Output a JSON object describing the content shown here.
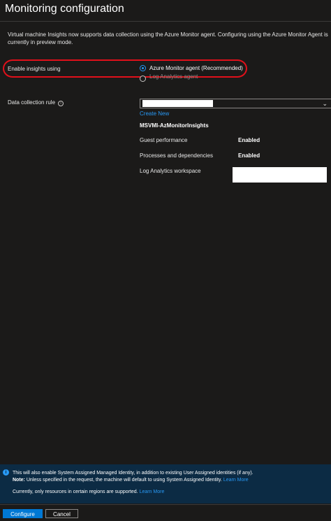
{
  "header": {
    "title": "Monitoring configuration"
  },
  "intro": {
    "text": "Virtual machine Insights now supports data collection using the Azure Monitor agent. Configuring using the Azure Monitor Agent is currently in preview mode."
  },
  "insights": {
    "label": "Enable insights using",
    "options": [
      {
        "label": "Azure Monitor agent (Recommended)",
        "selected": true
      },
      {
        "label": "Log Analytics agent",
        "selected": false
      }
    ]
  },
  "data_collection_rule": {
    "label": "Data collection rule",
    "info_icon": "info-icon",
    "create_new_link": "Create New",
    "rule_name": "MSVMI-AzMonitorInsights",
    "properties": [
      {
        "label": "Guest performance",
        "value": "Enabled"
      },
      {
        "label": "Processes and dependencies",
        "value": "Enabled"
      },
      {
        "label": "Log Analytics workspace",
        "value": ""
      }
    ]
  },
  "banner": {
    "line1": "This will also enable System Assigned Managed Identity, in addition to existing User Assigned identities (if any).",
    "note_label": "Note:",
    "line2": " Unless specified in the request, the machine will default to using System Assigned Identity. ",
    "learn_more_1": "Learn More",
    "line3": "Currently, only resources in certain regions are supported. ",
    "learn_more_2": "Learn More"
  },
  "footer": {
    "configure_label": "Configure",
    "cancel_label": "Cancel"
  },
  "colors": {
    "background": "#1b1a19",
    "accent": "#0078d4",
    "link": "#2899f5",
    "highlight": "#e1101a",
    "banner": "#0c2b44"
  }
}
